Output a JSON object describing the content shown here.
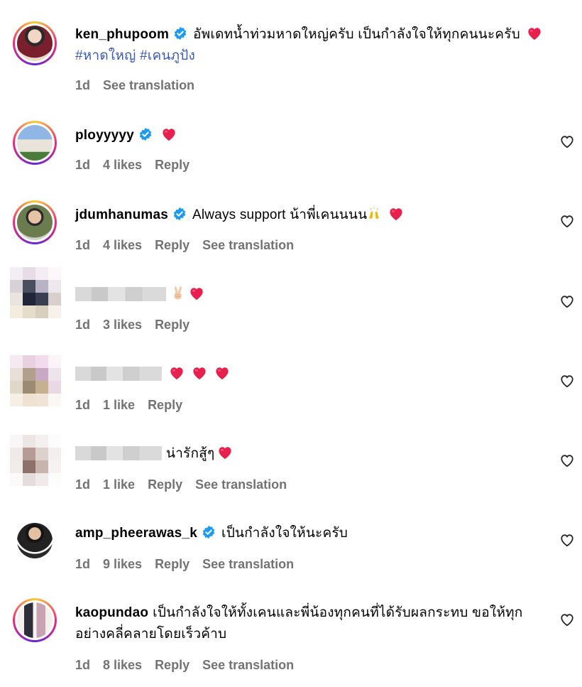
{
  "comments": [
    {
      "username": "ken_phupoom",
      "verified": true,
      "text": "อัพเดทน้ำท่วมหาดใหญ่ครับ เป็นกำลังใจให้ทุกคนนะครับ",
      "hashtags": [
        "#หาดใหญ่",
        "#เคนภูปัง"
      ],
      "time": "1d",
      "see_translation": "See translation"
    },
    {
      "username": "ployyyyy",
      "verified": true,
      "text": "",
      "time": "1d",
      "likes": "4 likes",
      "reply": "Reply"
    },
    {
      "username": "jdumhanumas",
      "verified": true,
      "text": "Always support น้าพี่เคนนนน",
      "time": "1d",
      "likes": "4 likes",
      "reply": "Reply",
      "see_translation": "See translation"
    },
    {
      "username": "",
      "text": "",
      "time": "1d",
      "likes": "3 likes",
      "reply": "Reply"
    },
    {
      "username": "",
      "text": "",
      "time": "1d",
      "likes": "1 like",
      "reply": "Reply"
    },
    {
      "username": "",
      "text": "น่ารักสู้ๆ",
      "time": "1d",
      "likes": "1 like",
      "reply": "Reply",
      "see_translation": "See translation"
    },
    {
      "username": "amp_pheerawas_k",
      "verified": true,
      "text": "เป็นกำลังใจให้นะครับ",
      "time": "1d",
      "likes": "9 likes",
      "reply": "Reply",
      "see_translation": "See translation"
    },
    {
      "username": "kaopundao",
      "verified": false,
      "text": "เป็นกำลังใจให้ทั้งเคนและพี่น้องทุกคนที่ได้รับผลกระทบ ขอให้ทุกอย่างคลี่คลายโดยเร็วค้าบ",
      "time": "1d",
      "likes": "8 likes",
      "reply": "Reply",
      "see_translation": "See translation"
    }
  ],
  "icons": {
    "verified": "verified-badge-icon",
    "heart_emoji": "red-heart-emoji",
    "like": "heart-outline-icon"
  },
  "colors": {
    "verified": "#1d9bf0",
    "hashtag": "#3c5bb7",
    "meta": "#737373",
    "heart": "#e8204e"
  }
}
